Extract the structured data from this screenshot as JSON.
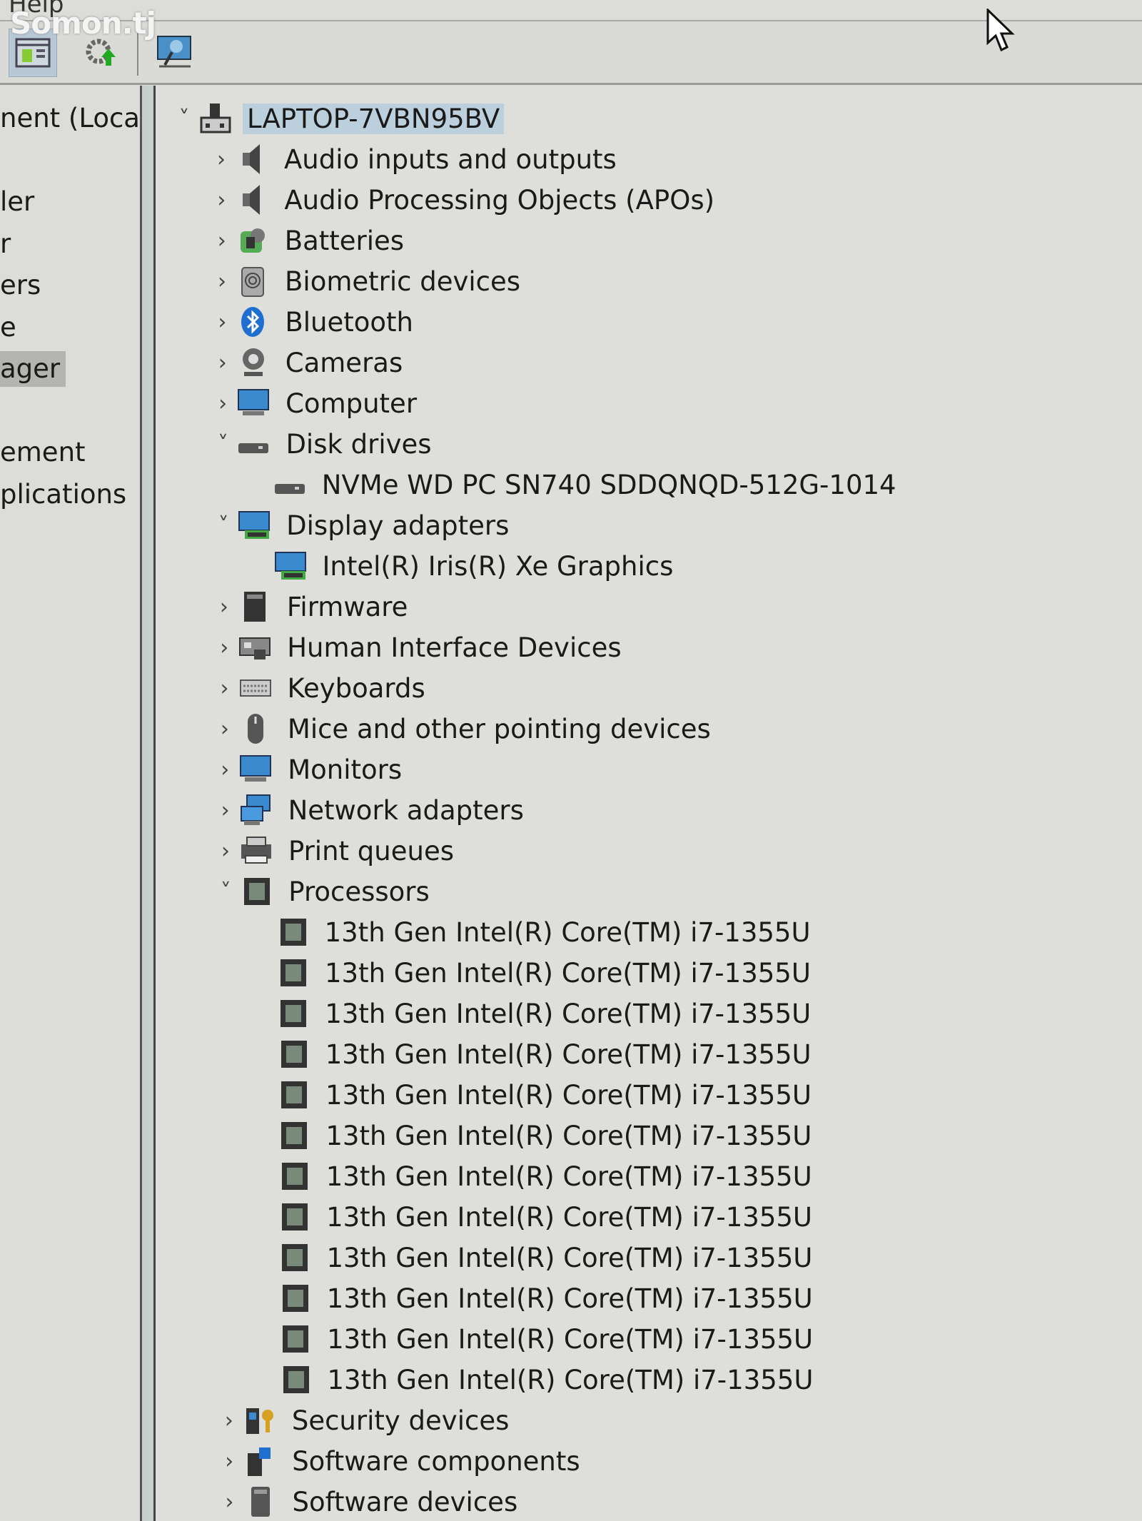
{
  "menubar": {
    "help_label": "Help"
  },
  "watermark": "Somon.tj",
  "toolbar": {
    "icons": [
      "properties-icon",
      "update-driver-icon",
      "scan-hardware-icon"
    ]
  },
  "left_pane": {
    "items": [
      {
        "label": "nent (Local)"
      },
      {
        "label": ""
      },
      {
        "label": "ler"
      },
      {
        "label": "r"
      },
      {
        "label": "ers"
      },
      {
        "label": "e"
      },
      {
        "label": "ager",
        "selected": true
      },
      {
        "label": ""
      },
      {
        "label": "ement"
      },
      {
        "label": "plications"
      }
    ]
  },
  "tree": {
    "root": {
      "label": "LAPTOP-7VBN95BV",
      "expanded": true,
      "icon": "computer-icon"
    },
    "rows": [
      {
        "label": "Audio inputs and outputs",
        "level": 1,
        "state": "collapsed",
        "icon": "speaker-icon"
      },
      {
        "label": "Audio Processing Objects (APOs)",
        "level": 1,
        "state": "collapsed",
        "icon": "speaker-icon"
      },
      {
        "label": "Batteries",
        "level": 1,
        "state": "collapsed",
        "icon": "battery-icon"
      },
      {
        "label": "Biometric devices",
        "level": 1,
        "state": "collapsed",
        "icon": "fingerprint-icon"
      },
      {
        "label": "Bluetooth",
        "level": 1,
        "state": "collapsed",
        "icon": "bluetooth-icon"
      },
      {
        "label": "Cameras",
        "level": 1,
        "state": "collapsed",
        "icon": "camera-icon"
      },
      {
        "label": "Computer",
        "level": 1,
        "state": "collapsed",
        "icon": "monitor-icon"
      },
      {
        "label": "Disk drives",
        "level": 1,
        "state": "expanded",
        "icon": "disk-icon"
      },
      {
        "label": "NVMe WD PC SN740 SDDQNQD-512G-1014",
        "level": 2,
        "state": "none",
        "icon": "disk-icon"
      },
      {
        "label": "Display adapters",
        "level": 1,
        "state": "expanded",
        "icon": "display-adapter-icon"
      },
      {
        "label": "Intel(R) Iris(R) Xe Graphics",
        "level": 2,
        "state": "none",
        "icon": "display-adapter-icon"
      },
      {
        "label": "Firmware",
        "level": 1,
        "state": "collapsed",
        "icon": "firmware-icon"
      },
      {
        "label": "Human Interface Devices",
        "level": 1,
        "state": "collapsed",
        "icon": "hid-icon"
      },
      {
        "label": "Keyboards",
        "level": 1,
        "state": "collapsed",
        "icon": "keyboard-icon"
      },
      {
        "label": "Mice and other pointing devices",
        "level": 1,
        "state": "collapsed",
        "icon": "mouse-icon"
      },
      {
        "label": "Monitors",
        "level": 1,
        "state": "collapsed",
        "icon": "monitor-icon"
      },
      {
        "label": "Network adapters",
        "level": 1,
        "state": "collapsed",
        "icon": "network-icon"
      },
      {
        "label": "Print queues",
        "level": 1,
        "state": "collapsed",
        "icon": "printer-icon"
      },
      {
        "label": "Processors",
        "level": 1,
        "state": "expanded",
        "icon": "processor-icon"
      },
      {
        "label": "13th Gen Intel(R) Core(TM) i7-1355U",
        "level": 2,
        "state": "none",
        "icon": "processor-icon"
      },
      {
        "label": "13th Gen Intel(R) Core(TM) i7-1355U",
        "level": 2,
        "state": "none",
        "icon": "processor-icon"
      },
      {
        "label": "13th Gen Intel(R) Core(TM) i7-1355U",
        "level": 2,
        "state": "none",
        "icon": "processor-icon"
      },
      {
        "label": "13th Gen Intel(R) Core(TM) i7-1355U",
        "level": 2,
        "state": "none",
        "icon": "processor-icon"
      },
      {
        "label": "13th Gen Intel(R) Core(TM) i7-1355U",
        "level": 2,
        "state": "none",
        "icon": "processor-icon"
      },
      {
        "label": "13th Gen Intel(R) Core(TM) i7-1355U",
        "level": 2,
        "state": "none",
        "icon": "processor-icon"
      },
      {
        "label": "13th Gen Intel(R) Core(TM) i7-1355U",
        "level": 2,
        "state": "none",
        "icon": "processor-icon"
      },
      {
        "label": "13th Gen Intel(R) Core(TM) i7-1355U",
        "level": 2,
        "state": "none",
        "icon": "processor-icon"
      },
      {
        "label": "13th Gen Intel(R) Core(TM) i7-1355U",
        "level": 2,
        "state": "none",
        "icon": "processor-icon"
      },
      {
        "label": "13th Gen Intel(R) Core(TM) i7-1355U",
        "level": 2,
        "state": "none",
        "icon": "processor-icon"
      },
      {
        "label": "13th Gen Intel(R) Core(TM) i7-1355U",
        "level": 2,
        "state": "none",
        "icon": "processor-icon"
      },
      {
        "label": "13th Gen Intel(R) Core(TM) i7-1355U",
        "level": 2,
        "state": "none",
        "icon": "processor-icon"
      },
      {
        "label": "Security devices",
        "level": 1,
        "state": "collapsed",
        "icon": "security-icon"
      },
      {
        "label": "Software components",
        "level": 1,
        "state": "collapsed",
        "icon": "software-component-icon"
      },
      {
        "label": "Software devices",
        "level": 1,
        "state": "collapsed",
        "icon": "software-device-icon"
      }
    ]
  },
  "colors": {
    "selection": "#bccfdc",
    "background": "#dededa"
  }
}
